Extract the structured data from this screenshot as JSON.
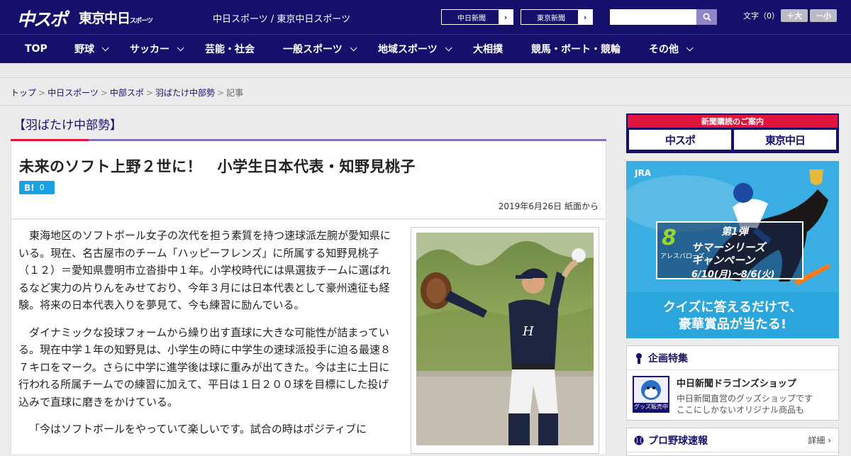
{
  "header": {
    "logo_chunichi_sports": "中スポ",
    "logo_tokyo_chunichi": "東京中日",
    "logo_tokyo_chunichi_small": "スポーツ",
    "site_title": "中日スポーツ / 東京中日スポーツ",
    "links": [
      {
        "label": "中日新聞",
        "arrow": "›"
      },
      {
        "label": "東京新聞",
        "arrow": "›"
      }
    ],
    "search_placeholder": "",
    "font_size_label": "文字（0）",
    "font_larger": "＋大",
    "font_smaller": "－小"
  },
  "nav": {
    "items": [
      {
        "label": "TOP",
        "has_menu": false
      },
      {
        "label": "野球",
        "has_menu": true
      },
      {
        "label": "サッカー",
        "has_menu": true
      },
      {
        "label": "芸能・社会",
        "has_menu": false
      },
      {
        "label": "一般スポーツ",
        "has_menu": true
      },
      {
        "label": "地域スポーツ",
        "has_menu": true
      },
      {
        "label": "大相撲",
        "has_menu": false
      },
      {
        "label": "競馬・ボート・競輪",
        "has_menu": false
      },
      {
        "label": "その他",
        "has_menu": true
      }
    ]
  },
  "breadcrumb": {
    "items": [
      "トップ",
      "中日スポーツ",
      "中部スポ",
      "羽ばたけ中部勢"
    ],
    "current": "記事",
    "separator": ">"
  },
  "article": {
    "section": "【羽ばたけ中部勢】",
    "headline": "未来のソフト上野２世に！　小学生日本代表・知野見桃子",
    "hatena_label": "B!",
    "hatena_count": "0",
    "dateline": "2019年6月26日 紙面から",
    "paragraphs": [
      "東海地区のソフトボール女子の次代を担う素質を持つ速球派左腕が愛知県にいる。現在、名古屋市のチーム「ハッピーフレンズ」に所属する知野見桃子（１２）＝愛知県豊明市立沓掛中１年。小学校時代には県選抜チームに選ばれるなど実力の片りんをみせており、今年３月には日本代表として豪州遠征も経験。将来の日本代表入りを夢見て、今も練習に励んでいる。",
      "ダイナミックな投球フォームから繰り出す直球に大きな可能性が詰まっている。現在中学１年の知野見は、小学生の時に中学生の速球派投手に迫る最速８７キロをマーク。さらに中学に進学後は球に重みが出てきた。今は主に土日に行われる所属チームでの練習に加えて、平日は１日２００球を目標にした投げ込みで直球に磨きをかけている。",
      "「今はソフトボールをやっていて楽しいです。試合の時はポジティブに"
    ]
  },
  "sidebar": {
    "subscription_title": "新聞購読のご案内",
    "subscription_logo_1": "中スポ",
    "subscription_logo_2": "東京中日",
    "jra": {
      "logo": "JRA",
      "sign_number": "8",
      "sign_name": "アレスバローズ",
      "sign_line1": "第1弾",
      "sign_line2": "サマーシリーズ",
      "sign_line3": "キャンペーン",
      "sign_dates": "6/10(月)～8/6(火)",
      "line1": "クイズに答えるだけで、",
      "line2": "豪華賞品が当たる!"
    },
    "features": {
      "title": "企画特集",
      "shop_title": "中日新聞ドラゴンズショップ",
      "shop_desc_1": "中日新聞直営のグッズショップです",
      "shop_desc_2": "ここにしかないオリジナル商品も",
      "thumb_tag": "グッズ販売中"
    },
    "baseball": {
      "title": "プロ野球速報",
      "link": "詳細 ›"
    }
  },
  "colors": {
    "brand_navy": "#15106b",
    "accent_red": "#e0143c",
    "accent_purple": "#8472b8",
    "hatena_blue": "#1aa0e6"
  }
}
